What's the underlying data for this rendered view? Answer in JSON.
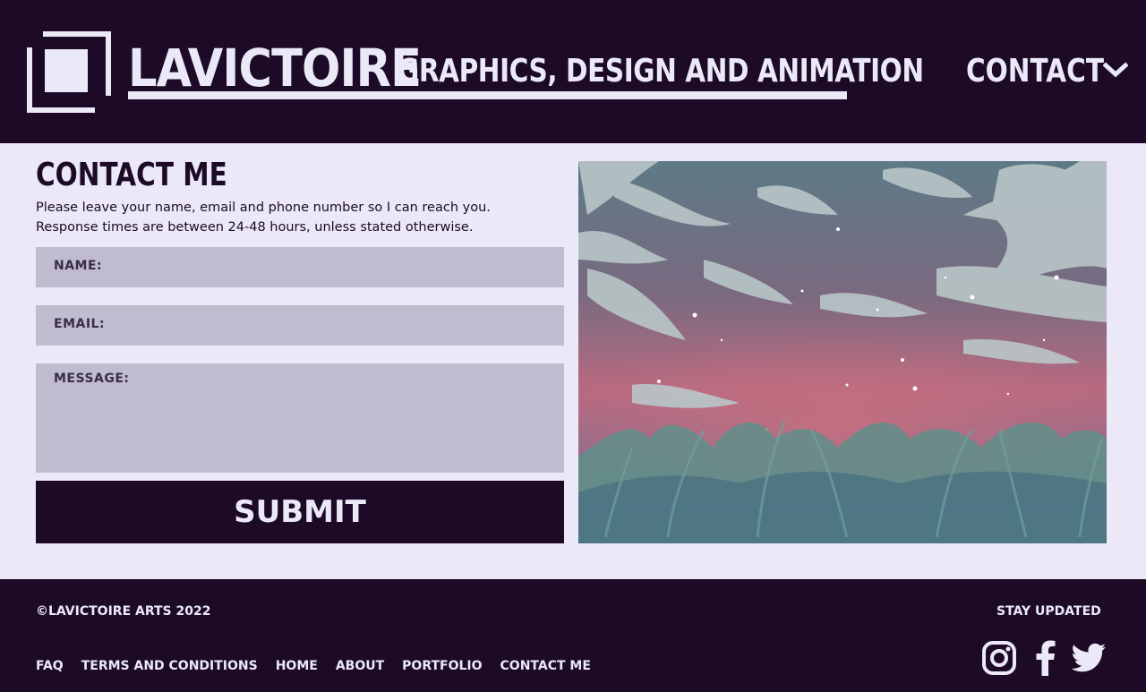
{
  "header": {
    "brand": "LAVICTOIRE",
    "tagline": "GRAPHICS, DESIGN AND ANIMATION",
    "nav_label": "CONTACT"
  },
  "main": {
    "title": "CONTACT ME",
    "description_line1": "Please leave your name, email and phone number so I can reach you.",
    "description_line2": "Response times are between 24-48 hours, unless stated otherwise.",
    "form": {
      "name_label": "NAME:",
      "email_label": "EMAIL:",
      "message_label": "MESSAGE:",
      "submit_label": "SUBMIT"
    }
  },
  "footer": {
    "copyright": "©LAVICTOIRE ARTS 2022",
    "stay_updated": "STAY UPDATED",
    "links": [
      "FAQ",
      "TERMS AND CONDITIONS",
      "HOME",
      "ABOUT",
      "PORTFOLIO",
      "CONTACT ME"
    ],
    "social_icons": [
      "instagram-icon",
      "facebook-icon",
      "twitter-icon"
    ]
  },
  "colors": {
    "dark": "#1c0a26",
    "light": "#ebe9f7",
    "field": "#c0bccf"
  }
}
